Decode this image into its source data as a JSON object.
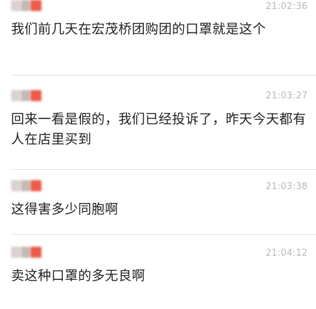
{
  "messages": [
    {
      "time": "21:02:36",
      "text": "我们前几天在宏茂桥团购团的口罩就是这个"
    },
    {
      "time": "21:03:27",
      "text": "回来一看是假的，我们已经投诉了，昨天今天都有人在店里买到"
    },
    {
      "time": "21:03:38",
      "text": "这得害多少同胞啊"
    },
    {
      "time": "21:04:12",
      "text": "卖这种口罩的多无良啊"
    }
  ],
  "colors": {
    "text": "#222222",
    "time": "#b8b8b8",
    "divider": "#e4e4e4",
    "avatar_accent": "#ec5a4a"
  }
}
